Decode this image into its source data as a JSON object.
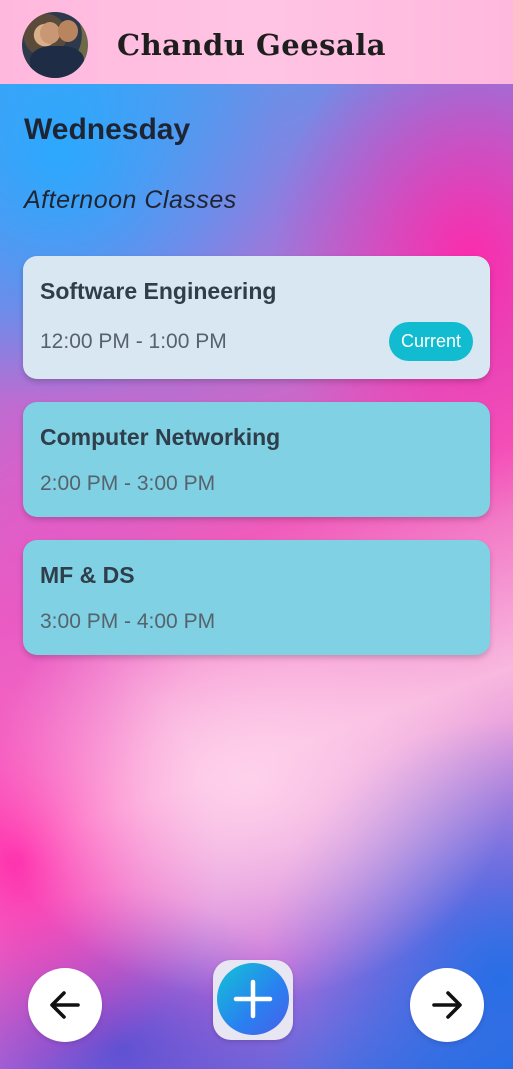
{
  "header": {
    "user_name": "Chandu Geesala",
    "avatar_icon": "user-avatar"
  },
  "day": {
    "title": "Wednesday",
    "section": "Afternoon Classes"
  },
  "classes": [
    {
      "name": "Software Engineering",
      "time": "12:00 PM - 1:00 PM",
      "badge": "Current"
    },
    {
      "name": "Computer Networking",
      "time": "2:00 PM - 3:00 PM"
    },
    {
      "name": "MF & DS",
      "time": "3:00 PM - 4:00 PM"
    }
  ],
  "icons": {
    "back": "arrow-left-icon",
    "add": "plus-icon",
    "forward": "arrow-right-icon"
  },
  "colors": {
    "current_card": "#d8e7f1",
    "card": "#7fd1e3",
    "badge": "#12bcd0"
  }
}
